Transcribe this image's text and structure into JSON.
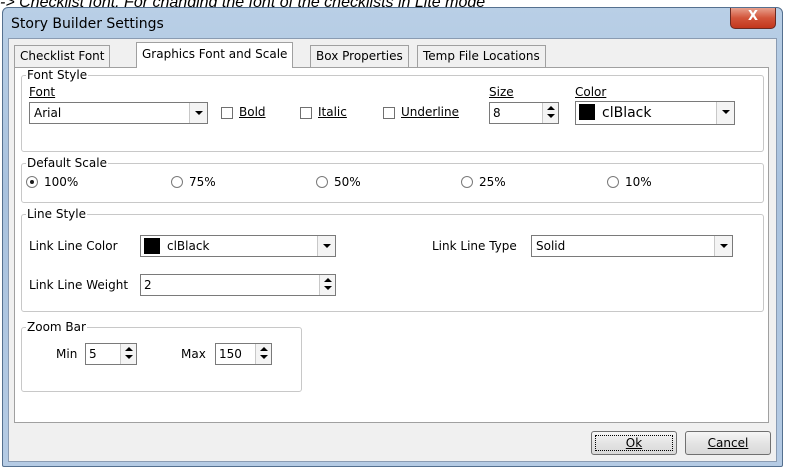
{
  "caption": "-> Checklist font. For changing the font of the checklists in Lite mode",
  "window": {
    "title": "Story Builder Settings",
    "close_glyph": "X"
  },
  "tabs": [
    {
      "label": "Checklist Font",
      "active": false
    },
    {
      "label": "Graphics Font and Scale",
      "active": true
    },
    {
      "label": "Box Properties",
      "active": false
    },
    {
      "label": "Temp File Locations",
      "active": false
    }
  ],
  "font_style": {
    "group_label": "Font Style",
    "font_label": "Font",
    "font_value": "Arial",
    "bold_label": "Bold",
    "italic_label": "Italic",
    "underline_label": "Underline",
    "size_label": "Size",
    "size_value": "8",
    "color_label": "Color",
    "color_value": "clBlack",
    "color_hex": "#000000"
  },
  "default_scale": {
    "group_label": "Default Scale",
    "options": [
      "100%",
      "75%",
      "50%",
      "25%",
      "10%"
    ],
    "selected": "100%"
  },
  "line_style": {
    "group_label": "Line Style",
    "link_color_label": "Link Line Color",
    "link_color_value": "clBlack",
    "link_color_hex": "#000000",
    "link_type_label": "Link Line Type",
    "link_type_value": "Solid",
    "link_weight_label": "Link Line Weight",
    "link_weight_value": "2"
  },
  "zoom_bar": {
    "group_label": "Zoom Bar",
    "min_label": "Min",
    "min_value": "5",
    "max_label": "Max",
    "max_value": "150"
  },
  "buttons": {
    "ok": "Ok",
    "cancel": "Cancel"
  }
}
